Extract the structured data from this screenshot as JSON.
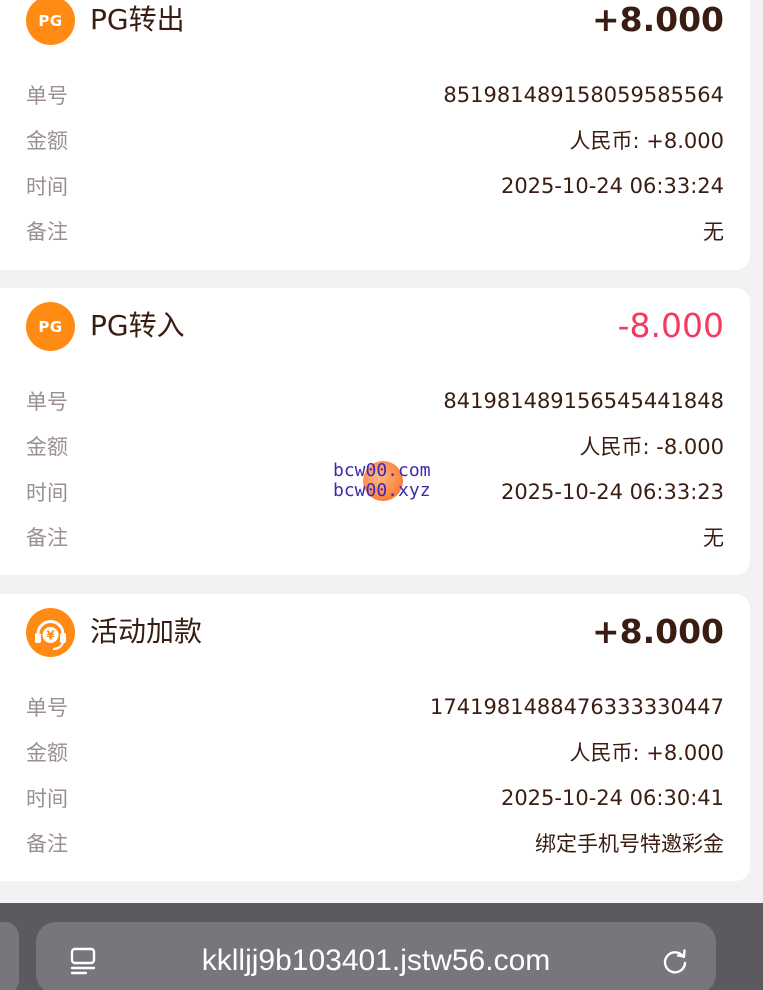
{
  "transactions": [
    {
      "icon": "pg-logo",
      "icon_text": "PG",
      "title": "PG转出",
      "amount": "+8.000",
      "amount_color": "#3a1d12",
      "rows": [
        {
          "label": "单号",
          "value": "851981489158059585564"
        },
        {
          "label": "金额",
          "value": "人民币: +8.000"
        },
        {
          "label": "时间",
          "value": "2025-10-24 06:33:24"
        },
        {
          "label": "备注",
          "value": "无"
        }
      ]
    },
    {
      "icon": "pg-logo",
      "icon_text": "PG",
      "title": "PG转入",
      "amount": "-8.000",
      "amount_color": "#f53a62",
      "rows": [
        {
          "label": "单号",
          "value": "841981489156545441848"
        },
        {
          "label": "金额",
          "value": "人民币: -8.000"
        },
        {
          "label": "时间",
          "value": "2025-10-24 06:33:23"
        },
        {
          "label": "备注",
          "value": "无"
        }
      ]
    },
    {
      "icon": "headset-yuan-icon",
      "title": "活动加款",
      "amount": "+8.000",
      "amount_color": "#3a1d12",
      "rows": [
        {
          "label": "单号",
          "value": "1741981488476333330447"
        },
        {
          "label": "金额",
          "value": "人民币: +8.000"
        },
        {
          "label": "时间",
          "value": "2025-10-24 06:30:41"
        },
        {
          "label": "备注",
          "value": "绑定手机号特邀彩金"
        }
      ]
    }
  ],
  "watermark": {
    "line1": "bcw00.com",
    "line2": "bcw00.xyz"
  },
  "browser": {
    "url": "kklljj9b103401.jstw56.com",
    "reader_icon": "reader-icon",
    "reload_icon": "reload-icon"
  },
  "colors": {
    "accent": "#ff8a14",
    "negative": "#f53a62",
    "text": "#3a1d12",
    "label": "#9a9090"
  }
}
